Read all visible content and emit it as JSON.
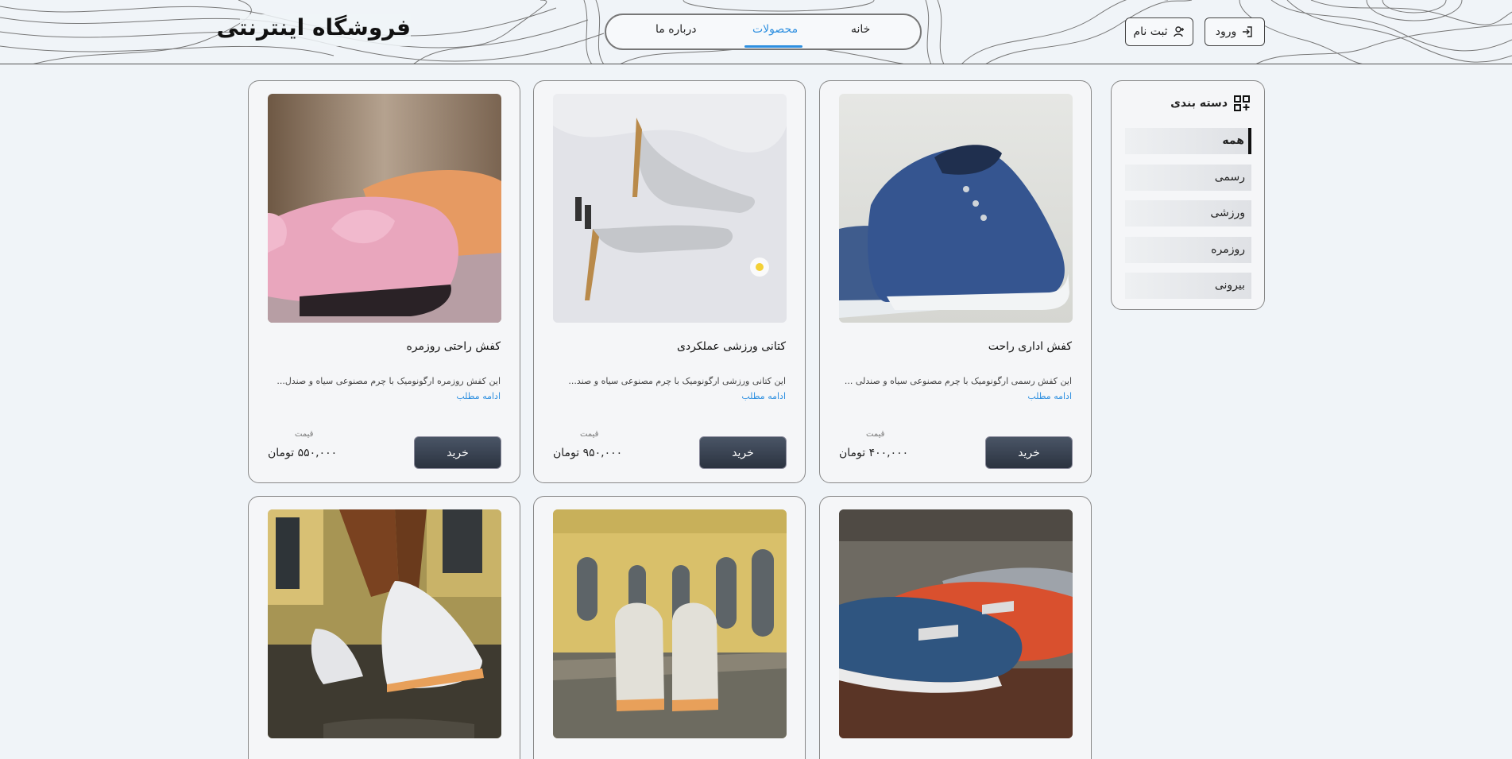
{
  "header": {
    "brand": "فروشگاه اینترنتی",
    "nav": [
      {
        "label": "خانه",
        "active": false
      },
      {
        "label": "محصولات",
        "active": true
      },
      {
        "label": "درباره ما",
        "active": false
      }
    ],
    "login_label": "ورود",
    "register_label": "ثبت نام",
    "accent_color": "#2d8fe0"
  },
  "sidebar": {
    "title": "دسته بندی",
    "items": [
      {
        "label": "همه",
        "active": true
      },
      {
        "label": "رسمی",
        "active": false
      },
      {
        "label": "ورزشی",
        "active": false
      },
      {
        "label": "روزمره",
        "active": false
      },
      {
        "label": "بیرونی",
        "active": false
      }
    ]
  },
  "products": [
    {
      "title": "کفش اداری راحت",
      "desc": "این کفش رسمی ارگونومیک با چرم مصنوعی سیاه و صندلی ...",
      "more": "ادامه مطلب",
      "price_label": "قیمت",
      "price": "۴۰۰,۰۰۰ تومان",
      "buy_label": "خرید",
      "image": "blue-canvas-sneakers"
    },
    {
      "title": "کتانی ورزشی عملکردی",
      "desc": "این کتانی ورزشی ارگونومیک با چرم مصنوعی سیاه و صند...",
      "more": "ادامه مطلب",
      "price_label": "قیمت",
      "price": "۹۵۰,۰۰۰ تومان",
      "buy_label": "خرید",
      "image": "silver-high-heels"
    },
    {
      "title": "کفش راحتی روزمره",
      "desc": "این کفش روزمره ارگونومیک با چرم مصنوعی سیاه و صندل...",
      "more": "ادامه مطلب",
      "price_label": "قیمت",
      "price": "۵۵۰,۰۰۰ تومان",
      "buy_label": "خرید",
      "image": "pink-bow-flats"
    },
    {
      "title": "",
      "desc": "",
      "more": "",
      "price_label": "",
      "price": "",
      "buy_label": "",
      "image": "blue-red-loafers"
    },
    {
      "title": "",
      "desc": "",
      "more": "",
      "price_label": "",
      "price": "",
      "buy_label": "",
      "image": "white-running-shoes-back"
    },
    {
      "title": "",
      "desc": "",
      "more": "",
      "price_label": "",
      "price": "",
      "buy_label": "",
      "image": "white-sneakers-walking"
    }
  ]
}
